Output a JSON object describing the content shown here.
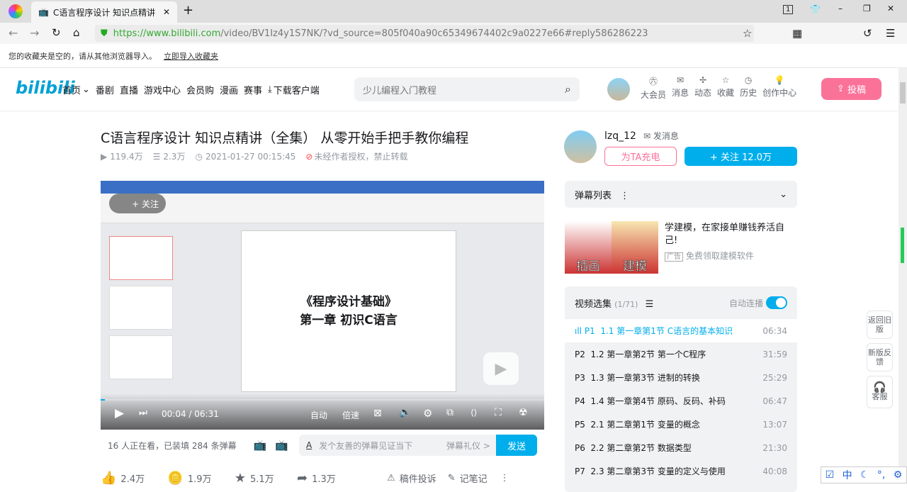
{
  "browser": {
    "tab_title": "C语言程序设计 知识点精讲",
    "url_host": "https://www.bilibili.com",
    "url_path": "/video/BV1Iz4y1S7NK/?vd_source=805f040a90c65349674402c9a0227e66#reply586286223",
    "bookmarks_empty": "您的收藏夹是空的，请从其他浏览器导入。",
    "import_link": "立即导入收藏夹",
    "tab_count": "1"
  },
  "header": {
    "logo": "bilibili",
    "nav": [
      "首页",
      "番剧",
      "直播",
      "游戏中心",
      "会员购",
      "漫画",
      "赛事",
      "下载客户端"
    ],
    "search_placeholder": "少儿编程入门教程",
    "icons": [
      "大会员",
      "消息",
      "动态",
      "收藏",
      "历史",
      "创作中心"
    ],
    "upload": "投稿"
  },
  "video": {
    "title": "C语言程序设计 知识点精讲（全集） 从零开始手把手教你编程",
    "views": "119.4万",
    "danmaku_count": "2.3万",
    "date": "2021-01-27 00:15:45",
    "copyright": "未经作者授权，禁止转载",
    "slide_title1": "《程序设计基础》",
    "slide_title2": "第一章 初识C语言",
    "follow_overlay": "+ 关注",
    "time_current": "00:04",
    "time_total": "06:31",
    "quality": "自动",
    "speed": "倍速",
    "progress": 0.01
  },
  "danmaku_bar": {
    "status": "16 人正在看，已装填 284 条弹幕",
    "placeholder": "发个友善的弹幕见证当下",
    "etiquette": "弹幕礼仪 >",
    "send": "发送"
  },
  "actions": {
    "like": "2.4万",
    "coin": "1.9万",
    "fav": "5.1万",
    "share": "1.3万",
    "report": "稿件投诉",
    "notes": "记笔记"
  },
  "uploader": {
    "name": "lzq_12",
    "message": "发消息",
    "charge": "为TA充电",
    "follow": "+ 关注 12.0万"
  },
  "danmaku_list": {
    "title": "弹幕列表"
  },
  "ad": {
    "img1": "插画",
    "img2": "建模",
    "title": "学建模，在家接单赚钱养活自己!",
    "tag": "广告",
    "sub": "免费领取建模软件"
  },
  "playlist": {
    "title": "视频选集",
    "count": "(1/71)",
    "autoplay": "自动连播",
    "items": [
      {
        "p": "P1",
        "title": "1.1 第一章第1节 C语言的基本知识",
        "dur": "06:34"
      },
      {
        "p": "P2",
        "title": "1.2 第一章第2节 第一个C程序",
        "dur": "31:59"
      },
      {
        "p": "P3",
        "title": "1.3 第一章第3节 进制的转换",
        "dur": "25:29"
      },
      {
        "p": "P4",
        "title": "1.4 第一章第4节 原码、反码、补码",
        "dur": "06:47"
      },
      {
        "p": "P5",
        "title": "2.1 第二章第1节 变量的概念",
        "dur": "13:07"
      },
      {
        "p": "P6",
        "title": "2.2 第二章第2节 数据类型",
        "dur": "21:30"
      },
      {
        "p": "P7",
        "title": "2.3 第二章第3节 变量的定义与使用",
        "dur": "40:08"
      }
    ]
  },
  "side": {
    "old": "返回旧版",
    "feedback": "新版反馈",
    "service": "客服"
  },
  "tray": {
    "ime": "中"
  },
  "colors": {
    "pink": "#fb7299",
    "blue": "#00aeec"
  }
}
